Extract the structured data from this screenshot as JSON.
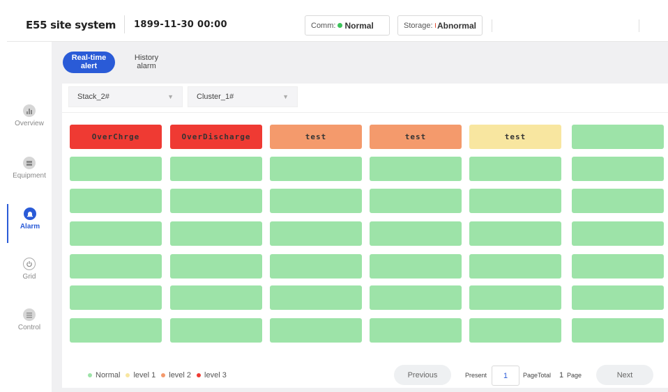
{
  "header": {
    "app_title": "E55 site system",
    "datetime": "1899-11-30 00:00",
    "comm": {
      "label": "Comm:",
      "value": "Normal",
      "color": "#3cc35a"
    },
    "storage": {
      "label": "Storage:",
      "value": "Abnormal",
      "color": "#e0452a"
    }
  },
  "sidebar": {
    "items": [
      {
        "label": "Overview",
        "icon": "bar-chart-icon"
      },
      {
        "label": "Equipment",
        "icon": "server-icon"
      },
      {
        "label": "Alarm",
        "icon": "alarm-bell-icon",
        "active": true
      },
      {
        "label": "Grid",
        "icon": "power-icon"
      },
      {
        "label": "Control",
        "icon": "list-control-icon"
      }
    ]
  },
  "tabs": {
    "realtime_line1": "Real-time",
    "realtime_line2": "alert",
    "history_line1": "History",
    "history_line2": "alarm"
  },
  "filters": {
    "stack": "Stack_2#",
    "cluster": "Cluster_1#"
  },
  "alarm_grid": {
    "rows": 7,
    "cols": 6,
    "cells": [
      {
        "text": "OverChrge",
        "level": 3
      },
      {
        "text": "OverDischarge",
        "level": 3
      },
      {
        "text": "test",
        "level": 2
      },
      {
        "text": "test",
        "level": 2
      },
      {
        "text": "test",
        "level": 1
      },
      {
        "text": "",
        "level": 0
      }
    ],
    "level_colors": {
      "0": "#9de3a8",
      "1": "#f8e6a0",
      "2": "#f49a6c",
      "3": "#ef3a33"
    }
  },
  "legend": {
    "normal": "Normal",
    "level1": "level 1",
    "level2": "level 2",
    "level3": "level 3"
  },
  "pagination": {
    "previous": "Previous",
    "present_label": "Present",
    "current_page": "1",
    "page_total_label": "PageTotal",
    "total_pages": "1",
    "page_suffix": "Page",
    "next": "Next"
  }
}
